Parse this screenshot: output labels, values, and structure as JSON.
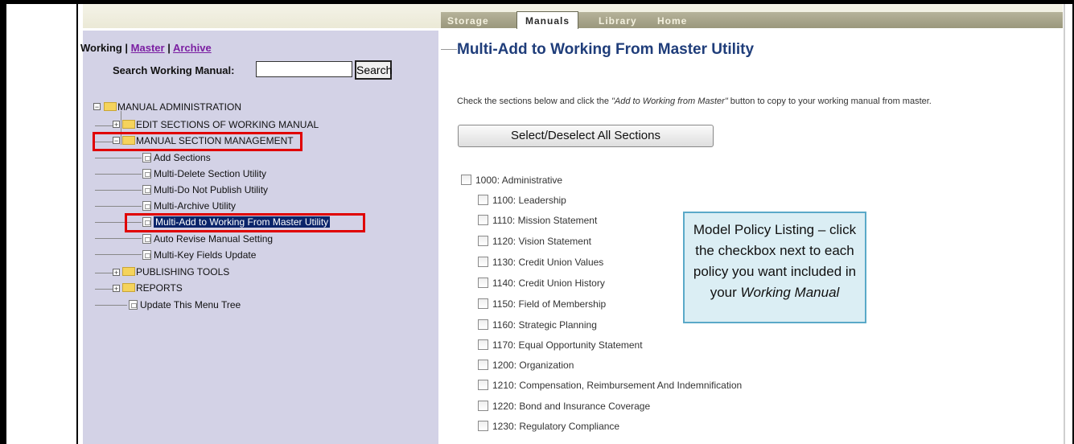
{
  "tabs": [
    {
      "label": "Storage",
      "active": false
    },
    {
      "label": "Manuals",
      "active": true
    },
    {
      "label": "Library",
      "active": false
    },
    {
      "label": "Home",
      "active": false
    }
  ],
  "sidebar": {
    "links": {
      "working": "Working",
      "sep": "|",
      "master": "Master",
      "archive": "Archive"
    },
    "search_label": "Search Working Manual:",
    "search_value": "",
    "search_button": "Search",
    "tree": [
      {
        "label": "MANUAL ADMINISTRATION",
        "type": "folder",
        "expander": "−"
      },
      {
        "label": "EDIT SECTIONS OF WORKING MANUAL",
        "type": "folder",
        "expander": "+"
      },
      {
        "label": "MANUAL SECTION MANAGEMENT",
        "type": "folder",
        "expander": "−"
      },
      {
        "label": "Add Sections",
        "type": "doc"
      },
      {
        "label": "Multi-Delete Section Utility",
        "type": "doc"
      },
      {
        "label": "Multi-Do Not Publish Utility",
        "type": "doc"
      },
      {
        "label": "Multi-Archive Utility",
        "type": "doc"
      },
      {
        "label": "Multi-Add to Working From Master Utility",
        "type": "doc",
        "selected": true
      },
      {
        "label": "Auto Revise Manual Setting",
        "type": "doc"
      },
      {
        "label": "Multi-Key Fields Update",
        "type": "doc"
      },
      {
        "label": "PUBLISHING TOOLS",
        "type": "folder",
        "expander": "+"
      },
      {
        "label": "REPORTS",
        "type": "folder",
        "expander": "+"
      },
      {
        "label": "Update This Menu Tree",
        "type": "doc"
      }
    ]
  },
  "main": {
    "title": "Multi-Add to Working From Master Utility",
    "instruction_pre": "Check the sections below and click the ",
    "instruction_em": "\"Add to Working from Master\"",
    "instruction_post": " button to copy to your working manual from master.",
    "select_all_button": "Select/Deselect All Sections",
    "sections": [
      {
        "label": "1000: Administrative",
        "checked": false
      },
      {
        "label": "1100: Leadership",
        "checked": false
      },
      {
        "label": "1110: Mission Statement",
        "checked": false
      },
      {
        "label": "1120: Vision Statement",
        "checked": false
      },
      {
        "label": "1130: Credit Union Values",
        "checked": false
      },
      {
        "label": "1140: Credit Union History",
        "checked": false
      },
      {
        "label": "1150: Field of Membership",
        "checked": false
      },
      {
        "label": "1160: Strategic Planning",
        "checked": false
      },
      {
        "label": "1170: Equal Opportunity Statement",
        "checked": false
      },
      {
        "label": "1200: Organization",
        "checked": false
      },
      {
        "label": "1210: Compensation, Reimbursement And Indemnification",
        "checked": false
      },
      {
        "label": "1220: Bond and Insurance Coverage",
        "checked": false
      },
      {
        "label": "1230: Regulatory Compliance",
        "checked": false
      }
    ]
  },
  "callout": {
    "line1": "Model Policy Listing – click",
    "line2": "the checkbox next to each",
    "line3": "policy you want included in",
    "line4_pre": "your ",
    "line4_em": "Working Manual"
  },
  "colors": {
    "sidebar_bg": "#d3d2e6",
    "title_color": "#1f3d7a",
    "highlight_red": "#e00000",
    "selected_bg": "#0a246a",
    "callout_bg": "#dbeef4",
    "callout_border": "#5aa9c8"
  }
}
